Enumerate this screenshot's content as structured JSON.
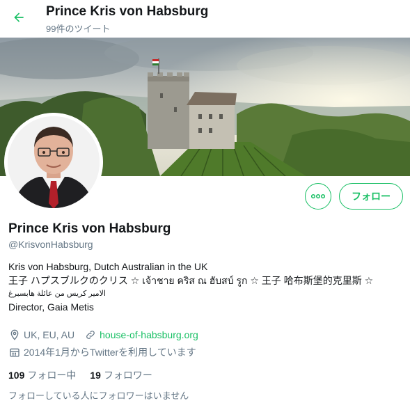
{
  "header": {
    "title": "Prince Kris von Habsburg",
    "tweet_count": "99件のツイート"
  },
  "profile": {
    "display_name": "Prince Kris von Habsburg",
    "handle": "@KrisvonHabsburg",
    "bio_lines": [
      "Kris von Habsburg, Dutch Australian in the UK",
      "王子 ハプスブルクのクリス ☆ เจ้าชาย คริส ณ ฮับสบ์ รูก ☆ 王子 哈布斯堡的克里斯 ☆",
      "الامير كريس من عائلة هابسبرغ",
      "Director, Gaia Metis"
    ],
    "location": "UK, EU, AU",
    "website": "house-of-habsburg.org",
    "joined": "2014年1月からTwitterを利用しています"
  },
  "actions": {
    "follow_label": "フォロー",
    "more_label": "∘∘∘"
  },
  "stats": {
    "following_count": "109",
    "following_label": "フォロー中",
    "followers_count": "19",
    "followers_label": "フォロワー"
  },
  "footnote": "フォローしている人にフォロワーはいません",
  "colors": {
    "accent": "#17bf63",
    "text": "#14171a",
    "muted": "#657786"
  },
  "icons": {
    "back": "arrow-left-icon",
    "location": "location-pin-icon",
    "link": "link-icon",
    "calendar": "calendar-icon",
    "more": "more-dots-icon"
  }
}
